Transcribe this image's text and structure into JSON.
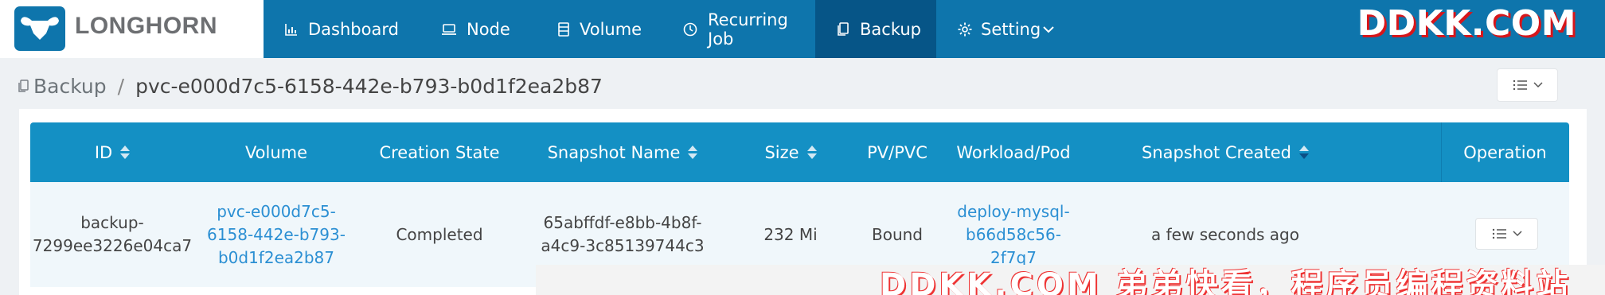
{
  "app": {
    "logo_text": "LONGHORN",
    "brand_watermark": "DDKK.COM",
    "bottom_watermark": "DDKK.COM 弟弟快看，程序员编程资料站"
  },
  "nav": {
    "items": [
      {
        "label": "Dashboard",
        "icon": "bar-chart-icon"
      },
      {
        "label": "Node",
        "icon": "laptop-icon"
      },
      {
        "label": "Volume",
        "icon": "database-icon"
      },
      {
        "label": "Recurring Job",
        "icon": "clock-icon"
      },
      {
        "label": "Backup",
        "icon": "copy-icon",
        "active": true
      },
      {
        "label": "Setting",
        "icon": "gear-icon"
      }
    ]
  },
  "breadcrumb": {
    "root": "Backup",
    "separator": "/",
    "current": "pvc-e000d7c5-6158-442e-b793-b0d1f2ea2b87"
  },
  "table": {
    "columns": [
      "ID",
      "Volume",
      "Creation State",
      "Snapshot Name",
      "Size",
      "PV/PVC",
      "Workload/Pod",
      "Snapshot Created",
      "Operation"
    ],
    "rows": [
      {
        "id": [
          "backup-",
          "7299ee3226e04ca7"
        ],
        "volume": [
          "pvc-e000d7c5-",
          "6158-442e-b793-",
          "b0d1f2ea2b87"
        ],
        "creation_state": "Completed",
        "snapshot_name": [
          "65abffdf-e8bb-4b8f-",
          "a4c9-3c85139744c3"
        ],
        "size": "232 Mi",
        "pv_pvc": "Bound",
        "workload": [
          "deploy-mysql-",
          "b66d58c56-",
          "2f7q7"
        ],
        "snapshot_created": "a few seconds ago"
      }
    ]
  },
  "colors": {
    "nav_bg": "#0e75ac",
    "nav_active": "#065587",
    "header_bg": "#1490c4",
    "link": "#2b8fd3"
  }
}
